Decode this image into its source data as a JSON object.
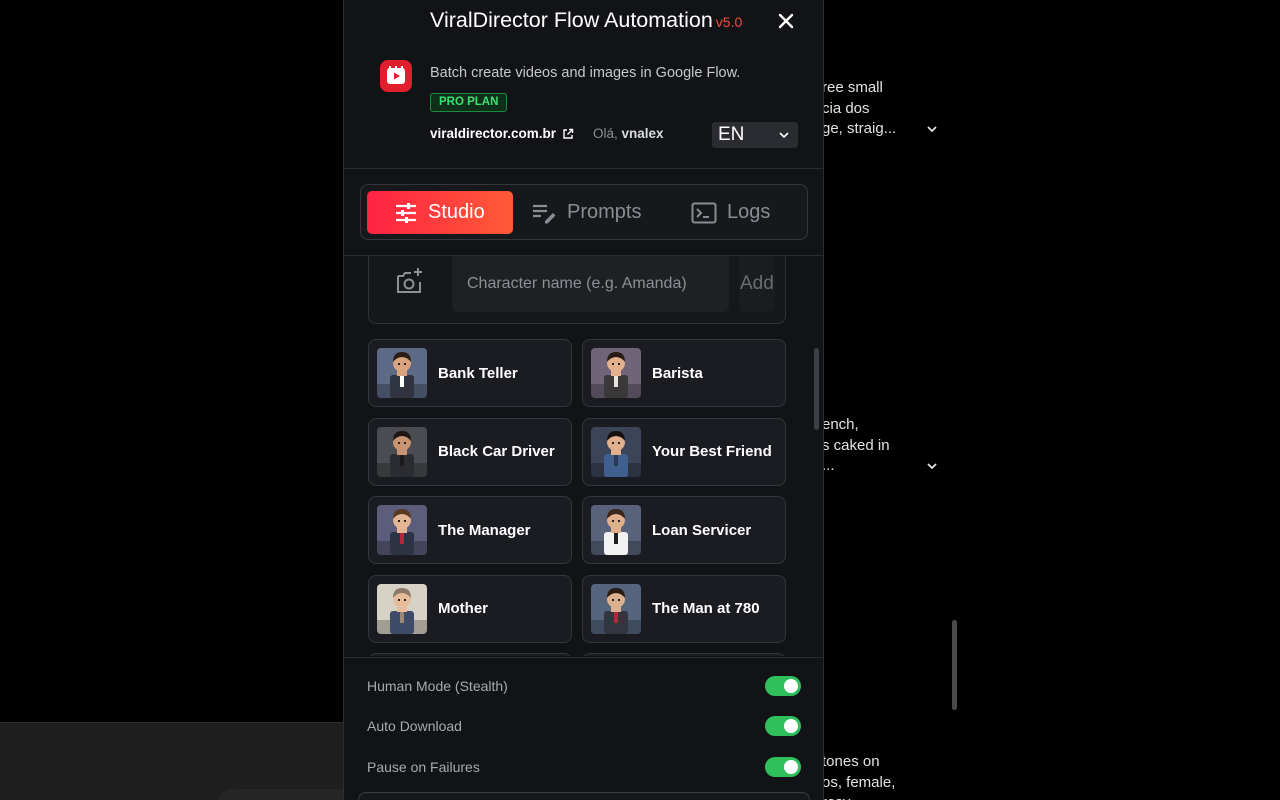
{
  "background": {
    "snippet_1": [
      "ree small",
      "cia dos",
      "ge, straig..."
    ],
    "snippet_2": [
      "ench,",
      "s caked in",
      "..."
    ],
    "snippet_3": [
      "tones on",
      "os, female,",
      "rosy"
    ]
  },
  "header": {
    "title": "ViralDirector Flow Automation",
    "version": "v5.0",
    "subtitle": "Batch create videos and images in Google Flow.",
    "plan": "PRO PLAN",
    "site": "viraldirector.com.br",
    "greeting_prefix": "Olá,",
    "user": "vnalex",
    "language": "EN"
  },
  "tabs": [
    {
      "label": "Studio",
      "icon": "sliders-icon",
      "active": true
    },
    {
      "label": "Prompts",
      "icon": "list-edit-icon",
      "active": false
    },
    {
      "label": "Logs",
      "icon": "terminal-icon",
      "active": false
    }
  ],
  "character_form": {
    "placeholder": "Character name (e.g. Amanda)",
    "add_label": "Add"
  },
  "characters": [
    {
      "name": "Bank Teller",
      "bg": "#5c6a86",
      "skin": "#d8a47f",
      "hair": "#2b1d16",
      "outfit": "#2f3440",
      "accent": "#ffffff"
    },
    {
      "name": "Barista",
      "bg": "#6f6478",
      "skin": "#e2b08d",
      "hair": "#2a1a14",
      "outfit": "#3a3838",
      "accent": "#e8e2d9"
    },
    {
      "name": "Black Car Driver",
      "bg": "#4a4c52",
      "skin": "#c99474",
      "hair": "#1d1612",
      "outfit": "#2b2c31",
      "accent": "#1a1a1c"
    },
    {
      "name": "Your Best Friend",
      "bg": "#3c4558",
      "skin": "#e0b08e",
      "hair": "#16110e",
      "outfit": "#3f5f8e",
      "accent": "#2b3a55"
    },
    {
      "name": "The Manager",
      "bg": "#5b5d7a",
      "skin": "#e3b594",
      "hair": "#5a3a22",
      "outfit": "#2d3344",
      "accent": "#b5263a"
    },
    {
      "name": "Loan Servicer",
      "bg": "#58627a",
      "skin": "#dfb08c",
      "hair": "#3a2618",
      "outfit": "#f2f2f2",
      "accent": "#1d1d22"
    },
    {
      "name": "Mother",
      "bg": "#d7d2c6",
      "skin": "#e6bd9c",
      "hair": "#8c7a68",
      "outfit": "#3d4b68",
      "accent": "#9a8a74"
    },
    {
      "name": "The Man at 780",
      "bg": "#55657e",
      "skin": "#dcb08f",
      "hair": "#2a1c14",
      "outfit": "#33363e",
      "accent": "#b5263a"
    }
  ],
  "settings": [
    {
      "label": "Human Mode (Stealth)",
      "enabled": true
    },
    {
      "label": "Auto Download",
      "enabled": true
    },
    {
      "label": "Pause on Failures",
      "enabled": true
    }
  ]
}
